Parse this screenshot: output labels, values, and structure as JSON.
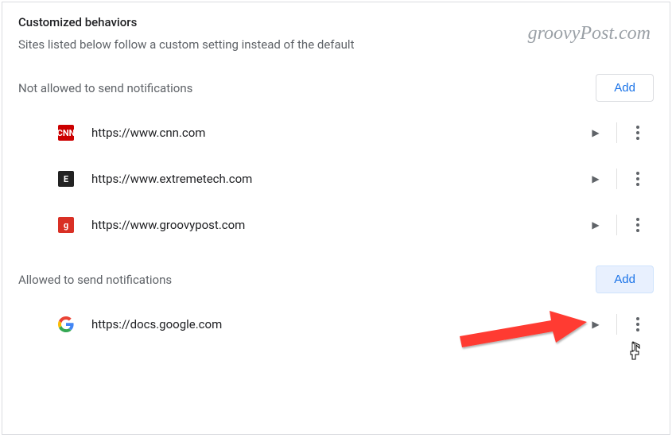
{
  "watermark": "groovyPost.com",
  "header": {
    "title": "Customized behaviors",
    "subtitle": "Sites listed below follow a custom setting instead of the default"
  },
  "sections": {
    "blocked": {
      "label": "Not allowed to send notifications",
      "add_label": "Add",
      "sites": [
        {
          "favicon_text": "CNN",
          "url": "https://www.cnn.com"
        },
        {
          "favicon_text": "E",
          "url": "https://www.extremetech.com"
        },
        {
          "favicon_text": "g",
          "url": "https://www.groovypost.com"
        }
      ]
    },
    "allowed": {
      "label": "Allowed to send notifications",
      "add_label": "Add",
      "sites": [
        {
          "favicon_text": "G",
          "url": "https://docs.google.com"
        }
      ]
    }
  }
}
